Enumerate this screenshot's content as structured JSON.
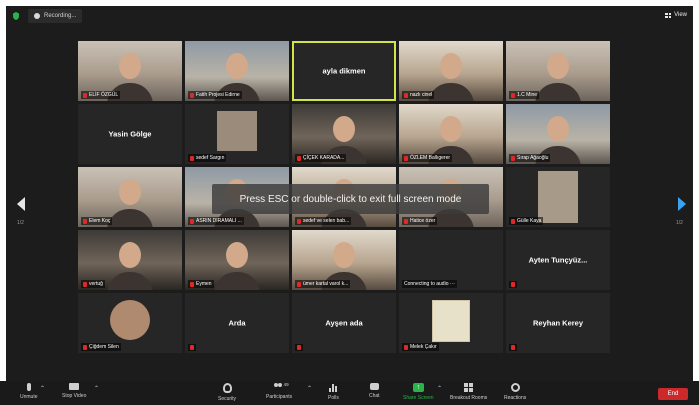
{
  "window": {
    "recording_label": "Recording...",
    "view_label": "View"
  },
  "notice": "Press ESC or double-click to exit full screen mode",
  "pagination": {
    "left": "1/2",
    "right": "1/2"
  },
  "tiles": [
    {
      "name": "ELİF ÖZGÜL",
      "mode": "video",
      "muted": true,
      "style": "cam"
    },
    {
      "name": "Fatih Projesi Edirne",
      "mode": "video",
      "muted": true,
      "style": "cam b"
    },
    {
      "name": "ayla dikmen",
      "mode": "name-only",
      "muted": false,
      "active": true
    },
    {
      "name": "nazlı cinel",
      "mode": "video",
      "muted": true,
      "style": "cam c"
    },
    {
      "name": "1.C Mine",
      "mode": "video",
      "muted": true,
      "style": "cam"
    },
    {
      "name": "Yasin Gölge",
      "mode": "name-only",
      "muted": false
    },
    {
      "name": "sedef Sargın",
      "mode": "thumb",
      "muted": true,
      "thumb": "thumb"
    },
    {
      "name": "ÇİÇEK KARADA...",
      "mode": "video",
      "muted": true,
      "style": "cam d"
    },
    {
      "name": "ÖZLEM Ballıgerer",
      "mode": "video",
      "muted": true,
      "style": "cam c"
    },
    {
      "name": "Sırap Ağaoğlu",
      "mode": "video",
      "muted": true,
      "style": "cam b"
    },
    {
      "name": "Elem Koç",
      "mode": "video",
      "muted": true,
      "style": "cam"
    },
    {
      "name": "ASRIN DIRAMALI ...",
      "mode": "video",
      "muted": true,
      "style": "cam b"
    },
    {
      "name": "sedef ve selen bab...",
      "mode": "video",
      "muted": true,
      "style": "cam c"
    },
    {
      "name": "Hatice özer",
      "mode": "video",
      "muted": true,
      "style": "cam"
    },
    {
      "name": "Gülle Kaya",
      "mode": "thumb",
      "muted": true,
      "thumb": "thumb tall"
    },
    {
      "name": "vertuğ",
      "mode": "video",
      "muted": true,
      "style": "cam d"
    },
    {
      "name": "Eymen",
      "mode": "video",
      "muted": true,
      "style": "cam d"
    },
    {
      "name": "ümer kartal varol k...",
      "mode": "video",
      "muted": true,
      "style": "cam c"
    },
    {
      "name": "Connecting to audio ···",
      "mode": "empty",
      "muted": false
    },
    {
      "name": "Ayten Tunçyüz...",
      "mode": "name-only",
      "muted": true
    },
    {
      "name": "Çiğdem Silen",
      "mode": "thumb",
      "muted": true,
      "thumb": "thumb round"
    },
    {
      "name": "Arda",
      "mode": "name-only",
      "muted": true
    },
    {
      "name": "Ayşen ada",
      "mode": "name-only",
      "muted": true
    },
    {
      "name": "Melek Çakır",
      "mode": "thumb",
      "muted": true,
      "thumb": "thumb poster"
    },
    {
      "name": "Reyhan Kerey",
      "mode": "name-only",
      "muted": true
    }
  ],
  "toolbar": {
    "unmute": "Unmute",
    "stop_video": "Stop Video",
    "security": "Security",
    "participants": "Participants",
    "participants_count": "49",
    "polls": "Polls",
    "chat": "Chat",
    "share_screen": "Share Screen",
    "breakout_rooms": "Breakout Rooms",
    "reactions": "Reactions",
    "end": "End"
  },
  "colors": {
    "active_speaker": "#d2e44a",
    "muted_icon": "#e02828",
    "share_green": "#2ab34b",
    "end_red": "#cc2a2a",
    "next_arrow": "#39a3f4"
  },
  "icons": [
    "shield-icon",
    "recording-icon",
    "view-grid-icon",
    "mic-muted-icon",
    "video-icon",
    "security-shield-icon",
    "participants-icon",
    "polls-icon",
    "chat-icon",
    "share-screen-icon",
    "breakout-rooms-icon",
    "reactions-icon",
    "chevron-up-icon"
  ]
}
